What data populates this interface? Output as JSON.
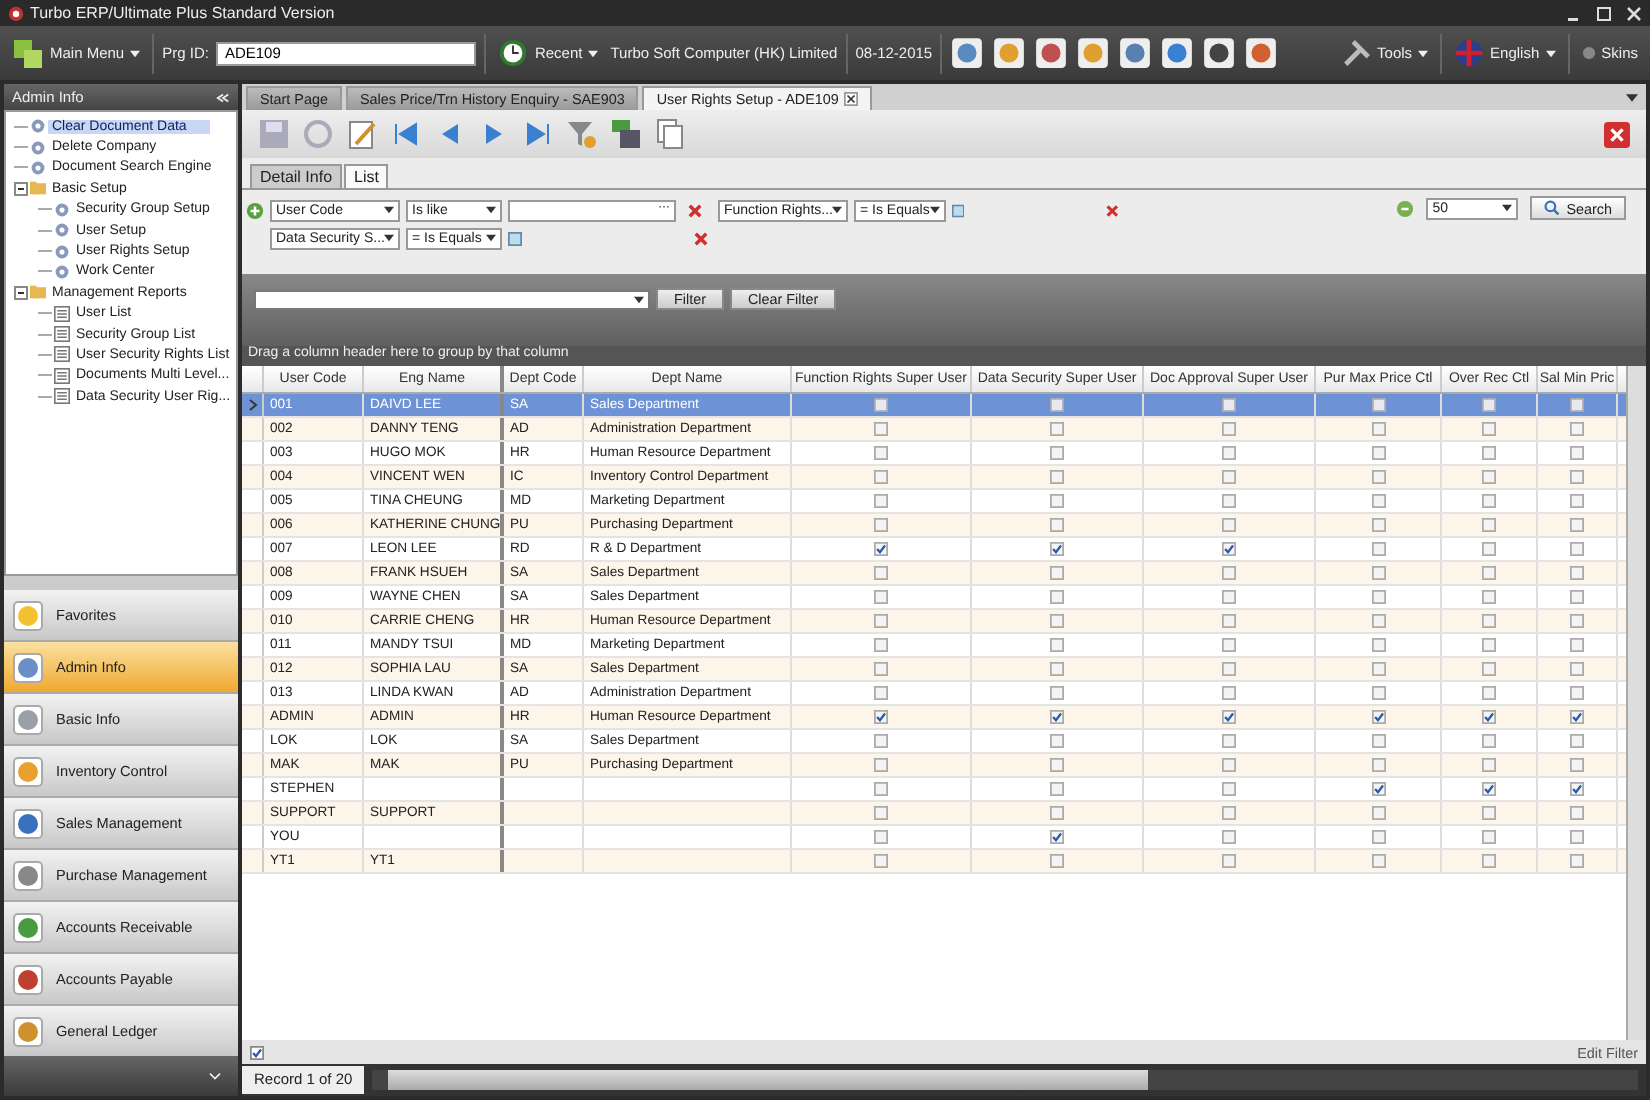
{
  "window": {
    "title": "Turbo ERP/Ultimate Plus Standard Version"
  },
  "toolbar": {
    "main_menu": "Main Menu",
    "prg_label": "Prg ID:",
    "prg_value": "ADE109",
    "recent": "Recent",
    "company": "Turbo Soft Computer (HK) Limited",
    "date": "08-12-2015",
    "tools": "Tools",
    "language": "English",
    "skins": "Skins"
  },
  "sidebar": {
    "title": "Admin Info",
    "tree": [
      {
        "label": "Clear Document Data",
        "selected": true
      },
      {
        "label": "Delete Company",
        "selected": false
      },
      {
        "label": "Document Search Engine",
        "selected": false
      },
      {
        "label": "Basic Setup",
        "selected": false,
        "expanded": true,
        "children": [
          {
            "label": "Security Group Setup",
            "selected": false
          },
          {
            "label": "User Setup",
            "selected": false
          },
          {
            "label": "User Rights Setup",
            "selected": false
          },
          {
            "label": "Work Center",
            "selected": false
          }
        ]
      },
      {
        "label": "Management Reports",
        "selected": false,
        "expanded": true,
        "children": [
          {
            "label": "User List",
            "selected": false
          },
          {
            "label": "Security Group List",
            "selected": false
          },
          {
            "label": "User Security Rights List",
            "selected": false
          },
          {
            "label": "Documents Multi Level...",
            "selected": false
          },
          {
            "label": "Data Security User Rig...",
            "selected": false
          }
        ]
      }
    ],
    "modules": [
      {
        "label": "Favorites",
        "selected": false
      },
      {
        "label": "Admin Info",
        "selected": true
      },
      {
        "label": "Basic Info",
        "selected": false
      },
      {
        "label": "Inventory Control",
        "selected": false
      },
      {
        "label": "Sales Management",
        "selected": false
      },
      {
        "label": "Purchase Management",
        "selected": false
      },
      {
        "label": "Accounts Receivable",
        "selected": false
      },
      {
        "label": "Accounts Payable",
        "selected": false
      },
      {
        "label": "General Ledger",
        "selected": false
      }
    ]
  },
  "doc_tabs": [
    {
      "label": "Start Page",
      "selected": false
    },
    {
      "label": "Sales Price/Trn History Enquiry - SAE903",
      "selected": false
    },
    {
      "label": "User Rights Setup - ADE109",
      "selected": true
    }
  ],
  "view_tabs": [
    {
      "label": "Detail Info",
      "selected": false
    },
    {
      "label": "List",
      "selected": true
    }
  ],
  "conditions": [
    {
      "kind": "text",
      "field": "User Code",
      "operator": "Is like",
      "ellipsis": "···"
    },
    {
      "kind": "check",
      "field": "Function Rights...",
      "operator": "= Is Equals",
      "checked": false
    },
    {
      "kind": "check",
      "field": "Data Security S...",
      "operator": "= Is Equals",
      "checked": false
    }
  ],
  "page_size": "50",
  "search_button": "Search",
  "filter_bar": {
    "filter_button": "Filter",
    "clear_button": "Clear Filter",
    "group_hint": "Drag a column header here to group by that column"
  },
  "grid": {
    "columns": [
      "User Code",
      "Eng Name",
      "Dept Code",
      "Dept Name",
      "Function Rights Super User",
      "Data Security Super User",
      "Doc Approval Super User",
      "Pur Max Price Ctl",
      "Over Rec Ctl",
      "Sal Min Pric"
    ],
    "rows": [
      {
        "selected": true,
        "user_code": "001",
        "eng_name": "DAIVD LEE",
        "dept_code": "SA",
        "dept_name": "Sales Department",
        "checks": [
          false,
          false,
          false,
          false,
          false,
          false
        ]
      },
      {
        "selected": false,
        "user_code": "002",
        "eng_name": "DANNY TENG",
        "dept_code": "AD",
        "dept_name": "Administration Department",
        "checks": [
          false,
          false,
          false,
          false,
          false,
          false
        ]
      },
      {
        "selected": false,
        "user_code": "003",
        "eng_name": "HUGO MOK",
        "dept_code": "HR",
        "dept_name": "Human Resource Department",
        "checks": [
          false,
          false,
          false,
          false,
          false,
          false
        ]
      },
      {
        "selected": false,
        "user_code": "004",
        "eng_name": "VINCENT WEN",
        "dept_code": "IC",
        "dept_name": "Inventory Control Department",
        "checks": [
          false,
          false,
          false,
          false,
          false,
          false
        ]
      },
      {
        "selected": false,
        "user_code": "005",
        "eng_name": "TINA CHEUNG",
        "dept_code": "MD",
        "dept_name": "Marketing Department",
        "checks": [
          false,
          false,
          false,
          false,
          false,
          false
        ]
      },
      {
        "selected": false,
        "user_code": "006",
        "eng_name": "KATHERINE CHUNG",
        "dept_code": "PU",
        "dept_name": "Purchasing Department",
        "checks": [
          false,
          false,
          false,
          false,
          false,
          false
        ]
      },
      {
        "selected": false,
        "user_code": "007",
        "eng_name": "LEON LEE",
        "dept_code": "RD",
        "dept_name": "R & D Department",
        "checks": [
          true,
          true,
          true,
          false,
          false,
          false
        ]
      },
      {
        "selected": false,
        "user_code": "008",
        "eng_name": "FRANK HSUEH",
        "dept_code": "SA",
        "dept_name": "Sales Department",
        "checks": [
          false,
          false,
          false,
          false,
          false,
          false
        ]
      },
      {
        "selected": false,
        "user_code": "009",
        "eng_name": "WAYNE CHEN",
        "dept_code": "SA",
        "dept_name": "Sales Department",
        "checks": [
          false,
          false,
          false,
          false,
          false,
          false
        ]
      },
      {
        "selected": false,
        "user_code": "010",
        "eng_name": "CARRIE CHENG",
        "dept_code": "HR",
        "dept_name": "Human Resource Department",
        "checks": [
          false,
          false,
          false,
          false,
          false,
          false
        ]
      },
      {
        "selected": false,
        "user_code": "011",
        "eng_name": "MANDY TSUI",
        "dept_code": "MD",
        "dept_name": "Marketing Department",
        "checks": [
          false,
          false,
          false,
          false,
          false,
          false
        ]
      },
      {
        "selected": false,
        "user_code": "012",
        "eng_name": "SOPHIA LAU",
        "dept_code": "SA",
        "dept_name": "Sales Department",
        "checks": [
          false,
          false,
          false,
          false,
          false,
          false
        ]
      },
      {
        "selected": false,
        "user_code": "013",
        "eng_name": "LINDA KWAN",
        "dept_code": "AD",
        "dept_name": "Administration Department",
        "checks": [
          false,
          false,
          false,
          false,
          false,
          false
        ]
      },
      {
        "selected": false,
        "user_code": "ADMIN",
        "eng_name": "ADMIN",
        "dept_code": "HR",
        "dept_name": "Human Resource Department",
        "checks": [
          true,
          true,
          true,
          true,
          true,
          true
        ]
      },
      {
        "selected": false,
        "user_code": "LOK",
        "eng_name": "LOK",
        "dept_code": "SA",
        "dept_name": "Sales Department",
        "checks": [
          false,
          false,
          false,
          false,
          false,
          false
        ]
      },
      {
        "selected": false,
        "user_code": "MAK",
        "eng_name": "MAK",
        "dept_code": "PU",
        "dept_name": "Purchasing Department",
        "checks": [
          false,
          false,
          false,
          false,
          false,
          false
        ]
      },
      {
        "selected": false,
        "user_code": "STEPHEN",
        "checks": [
          false,
          false,
          false,
          true,
          true,
          true
        ]
      },
      {
        "selected": false,
        "user_code": "SUPPORT",
        "eng_name": "SUPPORT",
        "checks": [
          false,
          false,
          false,
          false,
          false,
          false
        ]
      },
      {
        "selected": false,
        "user_code": "YOU",
        "checks": [
          false,
          true,
          false,
          false,
          false,
          false
        ]
      },
      {
        "selected": false,
        "user_code": "YT1",
        "eng_name": "YT1",
        "checks": [
          false,
          false,
          false,
          false,
          false,
          false
        ]
      }
    ]
  },
  "footer": {
    "filter_enabled": true,
    "edit_filter": "Edit Filter",
    "record": "Record 1 of 20"
  }
}
